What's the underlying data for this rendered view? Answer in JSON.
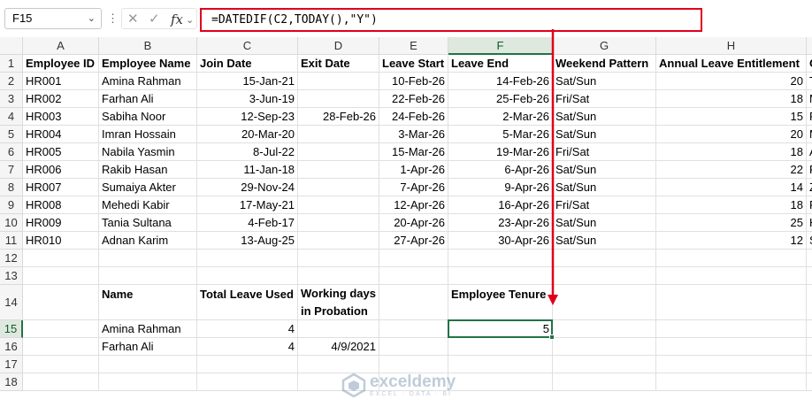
{
  "formula_bar": {
    "name_box": "F15",
    "formula": "=DATEDIF(C2,TODAY(),\"Y\")",
    "icons": [
      "chevron-down-icon",
      "more-options-icon",
      "cancel-icon",
      "enter-icon",
      "function-icon"
    ]
  },
  "columns": [
    "A",
    "B",
    "C",
    "D",
    "E",
    "F",
    "G",
    "H",
    "I"
  ],
  "selected_column": "F",
  "rows": [
    "1",
    "2",
    "3",
    "4",
    "5",
    "6",
    "7",
    "8",
    "9",
    "10",
    "11",
    "12",
    "13",
    "14",
    "15",
    "16",
    "17",
    "18"
  ],
  "selected_row": "15",
  "table": {
    "headers": [
      "Employee ID",
      "Employee Name",
      "Join Date",
      "Exit Date",
      "Leave Start",
      "Leave End",
      "Weekend Pattern",
      "Annual Leave Entitlement",
      "O"
    ],
    "records": [
      [
        "HR001",
        "Amina Rahman",
        "15-Jan-21",
        "",
        "10-Feb-26",
        "14-Feb-26",
        "Sat/Sun",
        "20",
        "T"
      ],
      [
        "HR002",
        "Farhan Ali",
        "3-Jun-19",
        "",
        "22-Feb-26",
        "25-Feb-26",
        "Fri/Sat",
        "18",
        "M"
      ],
      [
        "HR003",
        "Sabiha Noor",
        "12-Sep-23",
        "28-Feb-26",
        "24-Feb-26",
        "2-Mar-26",
        "Sat/Sun",
        "15",
        "R"
      ],
      [
        "HR004",
        "Imran Hossain",
        "20-Mar-20",
        "",
        "3-Mar-26",
        "5-Mar-26",
        "Sat/Sun",
        "20",
        "M"
      ],
      [
        "HR005",
        "Nabila Yasmin",
        "8-Jul-22",
        "",
        "15-Mar-26",
        "19-Mar-26",
        "Fri/Sat",
        "18",
        "A"
      ],
      [
        "HR006",
        "Rakib Hasan",
        "11-Jan-18",
        "",
        "1-Apr-26",
        "6-Apr-26",
        "Sat/Sun",
        "22",
        "F"
      ],
      [
        "HR007",
        "Sumaiya Akter",
        "29-Nov-24",
        "",
        "7-Apr-26",
        "9-Apr-26",
        "Sat/Sun",
        "14",
        "Z"
      ],
      [
        "HR008",
        "Mehedi Kabir",
        "17-May-21",
        "",
        "12-Apr-26",
        "16-Apr-26",
        "Fri/Sat",
        "18",
        "F"
      ],
      [
        "HR009",
        "Tania Sultana",
        "4-Feb-17",
        "",
        "20-Apr-26",
        "23-Apr-26",
        "Sat/Sun",
        "25",
        "H"
      ],
      [
        "HR010",
        "Adnan Karim",
        "13-Aug-25",
        "",
        "27-Apr-26",
        "30-Apr-26",
        "Sat/Sun",
        "12",
        "S"
      ]
    ]
  },
  "summary": {
    "headers": [
      "Name",
      "Total Leave Used",
      "Working days in Probation",
      "Employee Tenure"
    ],
    "rows": [
      [
        "Amina Rahman",
        "4",
        "",
        "5"
      ],
      [
        "Farhan Ali",
        "4",
        "4/9/2021",
        ""
      ]
    ]
  },
  "watermark": {
    "name": "exceldemy",
    "tagline": "EXCEL · DATA · BI"
  },
  "colors": {
    "accent_green": "#217346",
    "highlight_red": "#e0001b"
  }
}
